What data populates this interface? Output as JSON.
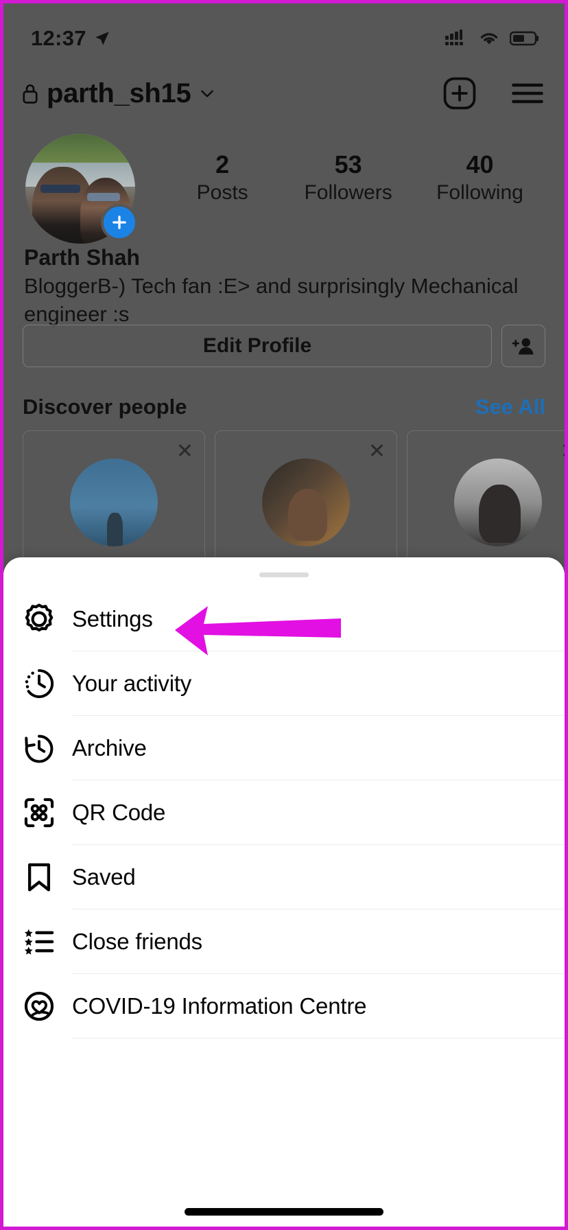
{
  "status_bar": {
    "time": "12:37",
    "location_icon": "location-arrow-icon",
    "signal_icon": "cellular-signal-icon",
    "wifi_icon": "wifi-icon",
    "battery_icon": "battery-icon"
  },
  "profile_header": {
    "lock_icon": "lock-icon",
    "username": "parth_sh15",
    "chevron_icon": "chevron-down-icon",
    "new_post_icon": "plus-box-icon",
    "menu_icon": "hamburger-menu-icon"
  },
  "profile": {
    "avatar_name": "profile-avatar",
    "add_story_icon": "plus-icon",
    "stats": [
      {
        "value": "2",
        "label": "Posts"
      },
      {
        "value": "53",
        "label": "Followers"
      },
      {
        "value": "40",
        "label": "Following"
      }
    ],
    "full_name": "Parth Shah",
    "bio": "BloggerB-) Tech fan :E> and surprisingly Mechanical engineer :s",
    "edit_profile_label": "Edit Profile",
    "add_person_icon": "add-person-icon"
  },
  "discover": {
    "title": "Discover people",
    "see_all_label": "See All",
    "dismiss_icon": "close-icon",
    "cards": [
      {
        "avatar_name": "suggested-user-avatar-1"
      },
      {
        "avatar_name": "suggested-user-avatar-2"
      },
      {
        "avatar_name": "suggested-user-avatar-3"
      }
    ]
  },
  "sheet": {
    "handle_name": "sheet-drag-handle",
    "items": [
      {
        "label": "Settings",
        "icon": "gear-icon"
      },
      {
        "label": "Your activity",
        "icon": "activity-clock-icon"
      },
      {
        "label": "Archive",
        "icon": "archive-history-icon"
      },
      {
        "label": "QR Code",
        "icon": "qr-code-icon"
      },
      {
        "label": "Saved",
        "icon": "bookmark-icon"
      },
      {
        "label": "Close friends",
        "icon": "close-friends-star-list-icon"
      },
      {
        "label": "COVID-19 Information Centre",
        "icon": "covid-heart-icon"
      }
    ]
  },
  "annotation": {
    "arrow_icon": "magenta-pointer-arrow",
    "points_to": "Settings",
    "color": "#e210e2"
  },
  "colors": {
    "border_highlight": "#d11ad1",
    "dimmed_overlay": "#575757",
    "sheet_background": "#ffffff",
    "link_blue": "#1d6fb8",
    "story_badge_blue": "#1b83e6"
  },
  "home_indicator": {
    "name": "home-indicator"
  }
}
